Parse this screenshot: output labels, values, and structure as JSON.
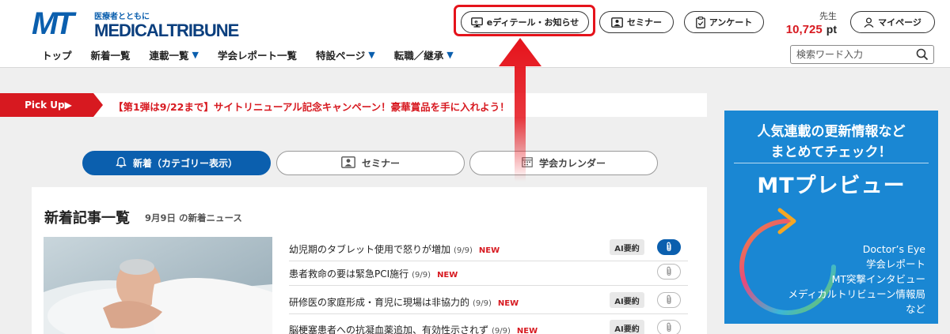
{
  "header": {
    "logo_mark": "MT",
    "logo_tagline": "医療者とともに",
    "logo_wordmark": "MEDICALTRIBUNE",
    "buttons": {
      "edition": "eディテール・お知らせ",
      "seminar": "セミナー",
      "survey": "アンケート",
      "mypage": "マイページ"
    },
    "points": {
      "label": "先生",
      "value": "10,725",
      "unit": "pt"
    },
    "search_placeholder": "検索ワード入力"
  },
  "nav": {
    "items": [
      {
        "label": "トップ",
        "dropdown": false
      },
      {
        "label": "新着一覧",
        "dropdown": false
      },
      {
        "label": "連載一覧",
        "dropdown": true
      },
      {
        "label": "学会レポート一覧",
        "dropdown": false
      },
      {
        "label": "特設ページ",
        "dropdown": true
      },
      {
        "label": "転職／継承",
        "dropdown": true
      }
    ],
    "dropdown_glyph": "▼"
  },
  "pickup": {
    "tag": "Pick Up▶",
    "text": "【第1弾は9/22まで】サイトリニューアル記念キャンペーン！豪華賞品を手に入れよう！"
  },
  "tabs": [
    {
      "label": "新着（カテゴリー表示）",
      "active": true
    },
    {
      "label": "セミナー",
      "active": false
    },
    {
      "label": "学会カレンダー",
      "active": false
    }
  ],
  "articles": {
    "title": "新着記事一覧",
    "subtitle": "9月9日 の新着ニュース",
    "new_label": "NEW",
    "ai_label": "AI要約",
    "rows": [
      {
        "title": "幼児期のタブレット使用で怒りが増加",
        "date": "(9/9)",
        "ai": true,
        "clipped": true
      },
      {
        "title": "患者救命の要は緊急PCI施行",
        "date": "(9/9)",
        "ai": false,
        "clipped": false
      },
      {
        "title": "研修医の家庭形成・育児に現場は非協力的",
        "date": "(9/9)",
        "ai": true,
        "clipped": false
      },
      {
        "title": "脳梗塞患者への抗凝血薬追加、有効性示されず",
        "date": "(9/9)",
        "ai": true,
        "clipped": false
      }
    ]
  },
  "ad": {
    "line1": "人気連載の更新情報など",
    "line2": "まとめてチェック！",
    "title": "MTプレビュー",
    "items": [
      "Doctor’s Eye",
      "学会レポート",
      "MT突撃インタビュー",
      "メディカルトリビューン情報局",
      "など"
    ]
  },
  "colors": {
    "brand_blue": "#0b5fae",
    "accent_red": "#d71920",
    "ad_blue": "#1a87d3"
  }
}
